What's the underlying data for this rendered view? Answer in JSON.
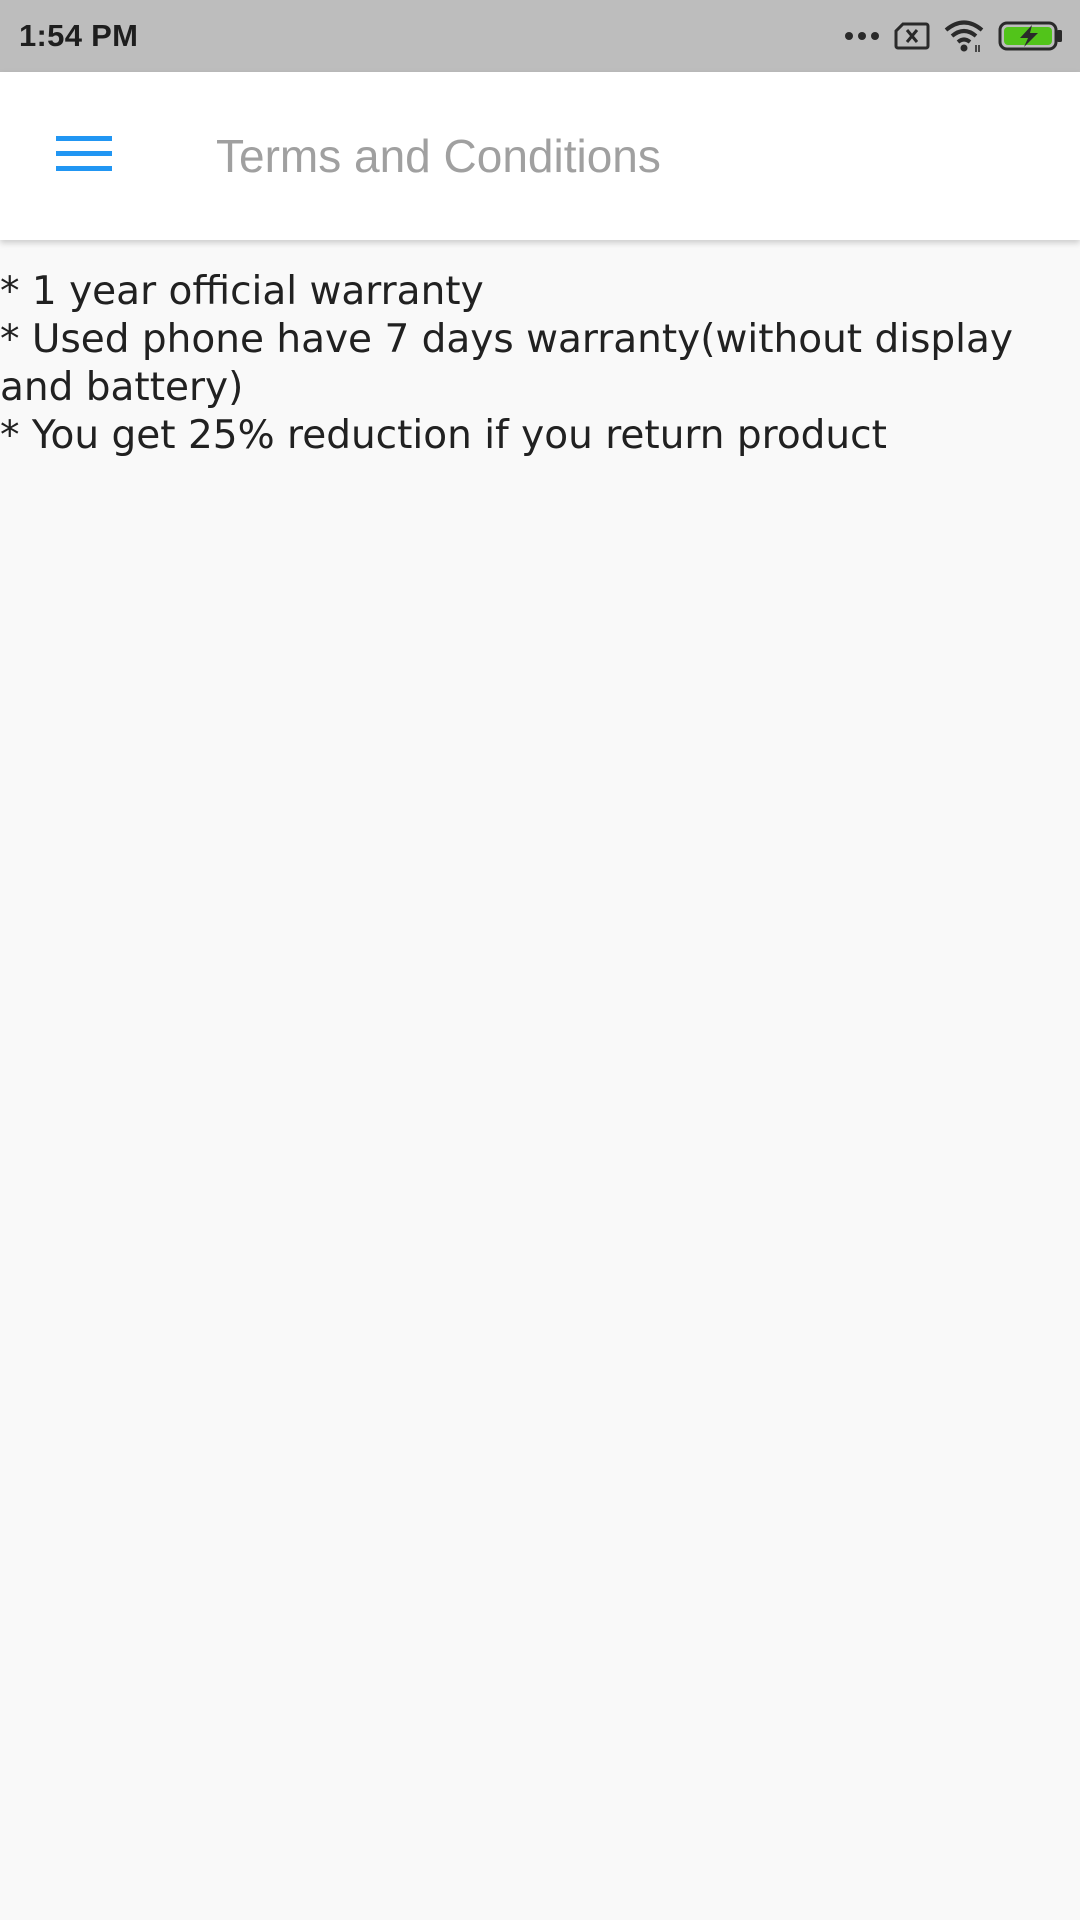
{
  "status_bar": {
    "time": "1:54 PM",
    "icons": [
      "more-dots-icon",
      "sim-error-icon",
      "wifi-icon",
      "battery-charging-icon"
    ],
    "battery_color": "#52c41a"
  },
  "app_bar": {
    "menu_icon": "hamburger-menu-icon",
    "menu_color": "#2196f3",
    "title": "Terms and Conditions"
  },
  "terms": {
    "lines": [
      "* 1 year official warranty",
      "* Used phone have 7 days warranty(without display and battery)",
      "* You get 25% reduction if you return product"
    ]
  }
}
